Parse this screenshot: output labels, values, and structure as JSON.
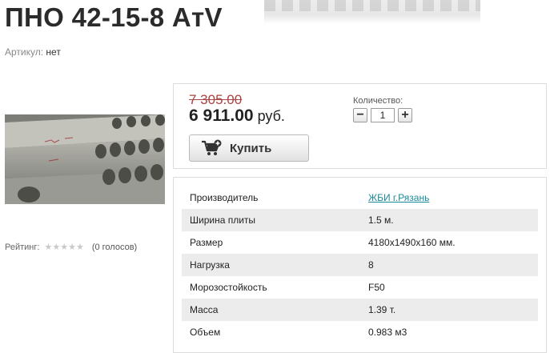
{
  "product": {
    "title": "ПНО 42-15-8 AтV",
    "sku_label": "Артикул:",
    "sku_value": "нет"
  },
  "rating": {
    "label": "Рейтинг:",
    "stars": 5,
    "filled": 0,
    "votes_text": "(0 голосов)"
  },
  "pricing": {
    "old_price": "7 305.00",
    "new_price": "6 911.00",
    "currency": "руб.",
    "quantity_label": "Количество:",
    "quantity_value": "1",
    "minus": "−",
    "plus": "+",
    "buy_label": "Купить"
  },
  "specs": [
    {
      "name": "Производитель",
      "value": "ЖБИ г.Рязань",
      "link": true
    },
    {
      "name": "Ширина плиты",
      "value": "1.5 м."
    },
    {
      "name": "Размер",
      "value": "4180x1490x160 мм."
    },
    {
      "name": "Нагрузка",
      "value": "8"
    },
    {
      "name": "Морозостойкость",
      "value": "F50"
    },
    {
      "name": "Масса",
      "value": "1.39 т."
    },
    {
      "name": "Объем",
      "value": "0.983 м3"
    }
  ],
  "colors": {
    "old_price": "#a94442",
    "link": "#1a8a9a",
    "row_alt": "#ececec"
  }
}
